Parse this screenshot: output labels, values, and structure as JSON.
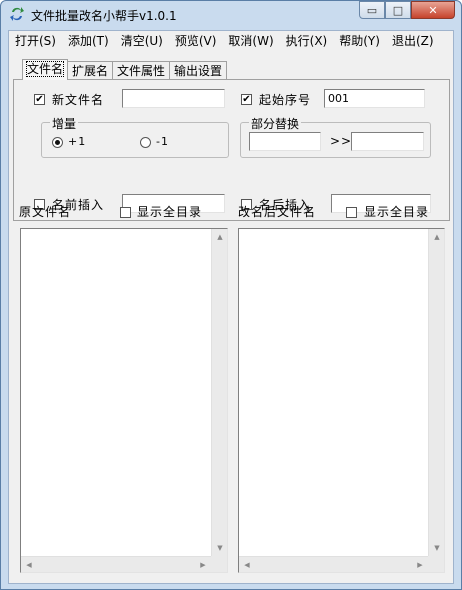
{
  "window": {
    "title": "文件批量改名小帮手v1.0.1",
    "minimize_glyph": "▭",
    "maximize_glyph": "□",
    "close_glyph": "✕"
  },
  "menu": {
    "open": "打开(S)",
    "add": "添加(T)",
    "clear": "清空(U)",
    "preview": "预览(V)",
    "cancel": "取消(W)",
    "execute": "执行(X)",
    "help": "帮助(Y)",
    "exit": "退出(Z)"
  },
  "tabs": {
    "filename": "文件名",
    "extension": "扩展名",
    "attributes": "文件属性",
    "output": "输出设置"
  },
  "options": {
    "new_name_label": "新文件名",
    "new_name_checked": "✔",
    "new_name_value": "",
    "start_no_label": "起始序号",
    "start_no_checked": "✔",
    "start_no_value": "001",
    "increment_title": "增量",
    "inc_plus": "+1",
    "inc_minus": "-1",
    "partial_replace_title": "部分替换",
    "replace_arrow": ">>",
    "replace_from": "",
    "replace_to": "",
    "prefix_label": "名前插入",
    "prefix_value": "",
    "suffix_label": "名后插入",
    "suffix_value": ""
  },
  "lists": {
    "original_label": "原文件名",
    "original_show_all": "显示全目录",
    "renamed_label": "改名后文件名",
    "renamed_show_all": "显示全目录"
  },
  "icons": {
    "app": "app-arrows-icon",
    "scroll_up": "▲",
    "scroll_down": "▼",
    "scroll_left": "◀",
    "scroll_right": "▶"
  },
  "colors": {
    "titlebar": "#c9dbee",
    "close_button": "#c6432b",
    "app_icon": "#1f7d3a"
  }
}
